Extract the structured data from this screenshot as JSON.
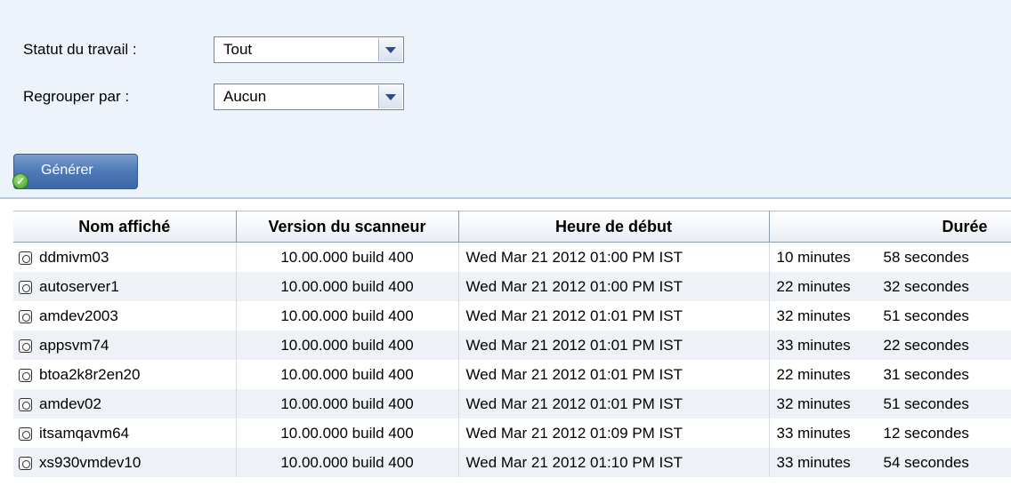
{
  "filters": {
    "status_label": "Statut du travail :",
    "status_value": "Tout",
    "group_label": "Regrouper par :",
    "group_value": "Aucun",
    "generate_label": "Générer"
  },
  "table": {
    "columns": [
      "Nom affiché",
      "Version du scanneur",
      "Heure de début",
      "Durée"
    ],
    "rows": [
      {
        "name": "ddmivm03",
        "version": "10.00.000 build 400",
        "start": "Wed Mar 21 2012 01:00 PM IST",
        "minutes": "10 minutes",
        "seconds": "58 secondes"
      },
      {
        "name": "autoserver1",
        "version": "10.00.000 build 400",
        "start": "Wed Mar 21 2012 01:00 PM IST",
        "minutes": "22 minutes",
        "seconds": "32 secondes"
      },
      {
        "name": "amdev2003",
        "version": "10.00.000 build 400",
        "start": "Wed Mar 21 2012 01:01 PM IST",
        "minutes": "32 minutes",
        "seconds": "51 secondes"
      },
      {
        "name": "appsvm74",
        "version": "10.00.000 build 400",
        "start": "Wed Mar 21 2012 01:01 PM IST",
        "minutes": "33 minutes",
        "seconds": "22 secondes"
      },
      {
        "name": "btoa2k8r2en20",
        "version": "10.00.000 build 400",
        "start": "Wed Mar 21 2012 01:01 PM IST",
        "minutes": "22 minutes",
        "seconds": "31 secondes"
      },
      {
        "name": "amdev02",
        "version": "10.00.000 build 400",
        "start": "Wed Mar 21 2012 01:01 PM IST",
        "minutes": "32 minutes",
        "seconds": "51 secondes"
      },
      {
        "name": "itsamqavm64",
        "version": "10.00.000 build 400",
        "start": "Wed Mar 21 2012 01:09 PM IST",
        "minutes": "33 minutes",
        "seconds": "12 secondes"
      },
      {
        "name": "xs930vmdev10",
        "version": "10.00.000 build 400",
        "start": "Wed Mar 21 2012 01:10 PM IST",
        "minutes": "33 minutes",
        "seconds": "54 secondes"
      }
    ]
  }
}
